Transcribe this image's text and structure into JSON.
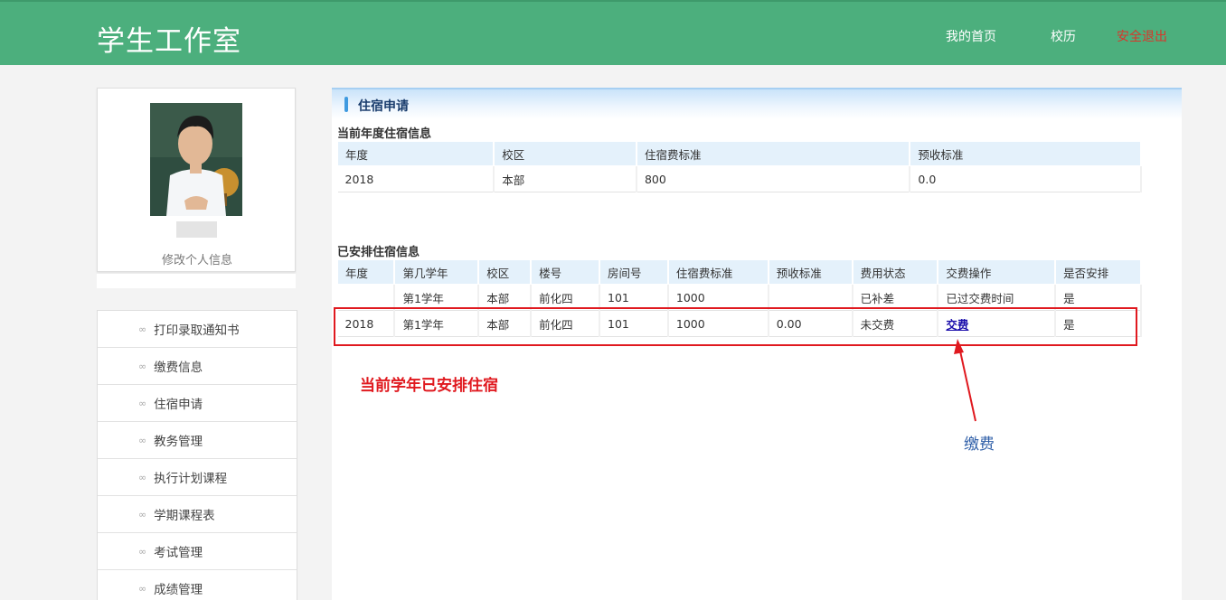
{
  "header": {
    "brand": "学生工作室",
    "nav": {
      "home": "我的首页",
      "calendar": "校历",
      "logout": "安全退出"
    }
  },
  "profile": {
    "edit_label": "修改个人信息"
  },
  "menu": {
    "items": [
      {
        "label": "打印录取通知书"
      },
      {
        "label": "缴费信息"
      },
      {
        "label": "住宿申请"
      },
      {
        "label": "教务管理"
      },
      {
        "label": "执行计划课程"
      },
      {
        "label": "学期课程表"
      },
      {
        "label": "考试管理"
      },
      {
        "label": "成绩管理"
      }
    ]
  },
  "main": {
    "title": "住宿申请",
    "current": {
      "title": "当前年度住宿信息",
      "headers": [
        "年度",
        "校区",
        "住宿费标准",
        "预收标准"
      ],
      "row": [
        "2018",
        "本部",
        "800",
        "0.0"
      ]
    },
    "arranged": {
      "title": "已安排住宿信息",
      "headers": [
        "年度",
        "第几学年",
        "校区",
        "楼号",
        "房间号",
        "住宿费标准",
        "预收标准",
        "费用状态",
        "交费操作",
        "是否安排"
      ],
      "rows": [
        [
          "",
          "第1学年",
          "本部",
          "前化四",
          "101",
          "1000",
          "",
          "已补差",
          "已过交费时间",
          "是"
        ],
        [
          "2018",
          "第1学年",
          "本部",
          "前化四",
          "101",
          "1000",
          "0.00",
          "未交费",
          "交费",
          "是"
        ]
      ]
    }
  },
  "annotations": {
    "highlight_text": "当前学年已安排住宿",
    "pay_label": "缴费",
    "color": "#e0191f"
  },
  "colors": {
    "header_green": "#4caf7d",
    "logout_red": "#d9362a",
    "table_header_bg": "#e4f1fb"
  }
}
